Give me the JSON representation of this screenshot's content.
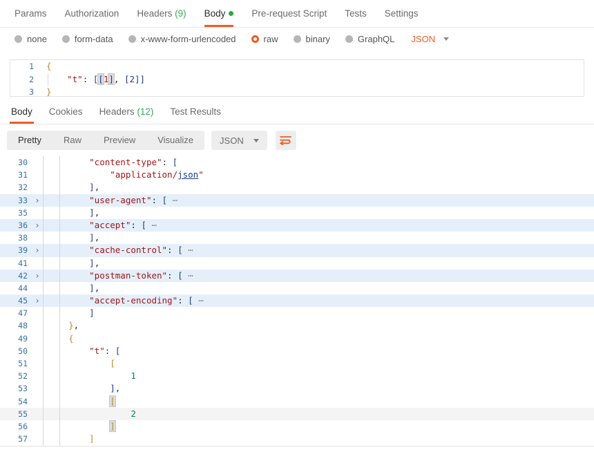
{
  "request": {
    "tabs": [
      {
        "label": "Params",
        "active": false
      },
      {
        "label": "Authorization",
        "active": false
      },
      {
        "label": "Headers",
        "count": "(9)",
        "active": false
      },
      {
        "label": "Body",
        "active": true,
        "dot": true
      },
      {
        "label": "Pre-request Script",
        "active": false
      },
      {
        "label": "Tests",
        "active": false
      },
      {
        "label": "Settings",
        "active": false
      }
    ],
    "body_modes": [
      {
        "label": "none",
        "selected": false
      },
      {
        "label": "form-data",
        "selected": false
      },
      {
        "label": "x-www-form-urlencoded",
        "selected": false
      },
      {
        "label": "raw",
        "selected": true
      },
      {
        "label": "binary",
        "selected": false
      },
      {
        "label": "GraphQL",
        "selected": false
      }
    ],
    "format": "JSON",
    "editor": {
      "lines": [
        {
          "num": "1",
          "tokens": [
            {
              "t": "{",
              "c": "t-brace"
            }
          ]
        },
        {
          "num": "2",
          "indent": true,
          "tokens": [
            {
              "t": "    ",
              "c": "t-punc"
            },
            {
              "t": "\"t\"",
              "c": "t-key"
            },
            {
              "t": ": ",
              "c": "t-punc"
            },
            {
              "t": "[",
              "c": "t-brk"
            },
            {
              "t": "[",
              "c": "t-brk bmatch"
            },
            {
              "t": "1",
              "c": "t-numr"
            },
            {
              "t": "]",
              "c": "t-brk bmatch"
            },
            {
              "t": ", ",
              "c": "t-punc"
            },
            {
              "t": "[2]",
              "c": "t-brk"
            },
            {
              "t": "]",
              "c": "t-brk"
            }
          ]
        },
        {
          "num": "3",
          "tokens": [
            {
              "t": "}",
              "c": "t-brace"
            }
          ]
        }
      ]
    }
  },
  "response": {
    "tabs": [
      {
        "label": "Body",
        "active": true
      },
      {
        "label": "Cookies",
        "active": false
      },
      {
        "label": "Headers",
        "count": "(12)",
        "active": false
      },
      {
        "label": "Test Results",
        "active": false
      }
    ],
    "view_modes": [
      {
        "label": "Pretty",
        "active": true
      },
      {
        "label": "Raw",
        "active": false
      },
      {
        "label": "Preview",
        "active": false
      },
      {
        "label": "Visualize",
        "active": false
      }
    ],
    "format": "JSON",
    "wrap_icon": "word-wrap-icon",
    "lines": [
      {
        "num": "30",
        "fold": "",
        "hl": false,
        "tokens": [
          {
            "t": "      ",
            "c": "t-punc"
          },
          {
            "t": "\"content-type\"",
            "c": "t-key"
          },
          {
            "t": ": ",
            "c": "t-punc"
          },
          {
            "t": "[",
            "c": "t-brk"
          }
        ]
      },
      {
        "num": "31",
        "fold": "",
        "hl": false,
        "tokens": [
          {
            "t": "          ",
            "c": "t-punc"
          },
          {
            "t": "\"application/",
            "c": "t-str"
          },
          {
            "t": "json",
            "c": "t-link"
          },
          {
            "t": "\"",
            "c": "t-str"
          }
        ]
      },
      {
        "num": "32",
        "fold": "",
        "hl": false,
        "tokens": [
          {
            "t": "      ",
            "c": "t-punc"
          },
          {
            "t": "]",
            "c": "t-brk"
          },
          {
            "t": ",",
            "c": "t-punc"
          }
        ]
      },
      {
        "num": "33",
        "fold": "›",
        "hl": true,
        "tokens": [
          {
            "t": "      ",
            "c": "t-punc"
          },
          {
            "t": "\"user-agent\"",
            "c": "t-key"
          },
          {
            "t": ": ",
            "c": "t-punc"
          },
          {
            "t": "[",
            "c": "t-brk"
          },
          {
            "t": " ⋯",
            "c": "t-ell"
          }
        ]
      },
      {
        "num": "35",
        "fold": "",
        "hl": false,
        "tokens": [
          {
            "t": "      ",
            "c": "t-punc"
          },
          {
            "t": "]",
            "c": "t-brk"
          },
          {
            "t": ",",
            "c": "t-punc"
          }
        ]
      },
      {
        "num": "36",
        "fold": "›",
        "hl": true,
        "tokens": [
          {
            "t": "      ",
            "c": "t-punc"
          },
          {
            "t": "\"accept\"",
            "c": "t-key"
          },
          {
            "t": ": ",
            "c": "t-punc"
          },
          {
            "t": "[",
            "c": "t-brk"
          },
          {
            "t": " ⋯",
            "c": "t-ell"
          }
        ]
      },
      {
        "num": "38",
        "fold": "",
        "hl": false,
        "tokens": [
          {
            "t": "      ",
            "c": "t-punc"
          },
          {
            "t": "]",
            "c": "t-brk"
          },
          {
            "t": ",",
            "c": "t-punc"
          }
        ]
      },
      {
        "num": "39",
        "fold": "›",
        "hl": true,
        "tokens": [
          {
            "t": "      ",
            "c": "t-punc"
          },
          {
            "t": "\"cache-control\"",
            "c": "t-key"
          },
          {
            "t": ": ",
            "c": "t-punc"
          },
          {
            "t": "[",
            "c": "t-brk"
          },
          {
            "t": " ⋯",
            "c": "t-ell"
          }
        ]
      },
      {
        "num": "41",
        "fold": "",
        "hl": false,
        "tokens": [
          {
            "t": "      ",
            "c": "t-punc"
          },
          {
            "t": "]",
            "c": "t-brk"
          },
          {
            "t": ",",
            "c": "t-punc"
          }
        ]
      },
      {
        "num": "42",
        "fold": "›",
        "hl": true,
        "tokens": [
          {
            "t": "      ",
            "c": "t-punc"
          },
          {
            "t": "\"postman-token\"",
            "c": "t-key"
          },
          {
            "t": ": ",
            "c": "t-punc"
          },
          {
            "t": "[",
            "c": "t-brk"
          },
          {
            "t": " ⋯",
            "c": "t-ell"
          }
        ]
      },
      {
        "num": "44",
        "fold": "",
        "hl": false,
        "tokens": [
          {
            "t": "      ",
            "c": "t-punc"
          },
          {
            "t": "]",
            "c": "t-brk"
          },
          {
            "t": ",",
            "c": "t-punc"
          }
        ]
      },
      {
        "num": "45",
        "fold": "›",
        "hl": true,
        "tokens": [
          {
            "t": "      ",
            "c": "t-punc"
          },
          {
            "t": "\"accept-encoding\"",
            "c": "t-key"
          },
          {
            "t": ": ",
            "c": "t-punc"
          },
          {
            "t": "[",
            "c": "t-brk"
          },
          {
            "t": " ⋯",
            "c": "t-ell"
          }
        ]
      },
      {
        "num": "47",
        "fold": "",
        "hl": false,
        "tokens": [
          {
            "t": "      ",
            "c": "t-punc"
          },
          {
            "t": "]",
            "c": "t-brk"
          }
        ]
      },
      {
        "num": "48",
        "fold": "",
        "hl": false,
        "tokens": [
          {
            "t": "  ",
            "c": "t-punc"
          },
          {
            "t": "}",
            "c": "t-brace"
          },
          {
            "t": ",",
            "c": "t-punc"
          }
        ]
      },
      {
        "num": "49",
        "fold": "",
        "hl": false,
        "tokens": [
          {
            "t": "  ",
            "c": "t-punc"
          },
          {
            "t": "{",
            "c": "t-brace"
          }
        ]
      },
      {
        "num": "50",
        "fold": "",
        "hl": false,
        "tokens": [
          {
            "t": "      ",
            "c": "t-punc"
          },
          {
            "t": "\"t\"",
            "c": "t-key"
          },
          {
            "t": ": ",
            "c": "t-punc"
          },
          {
            "t": "[",
            "c": "t-brk"
          }
        ]
      },
      {
        "num": "51",
        "fold": "",
        "hl": false,
        "tokens": [
          {
            "t": "          ",
            "c": "t-punc"
          },
          {
            "t": "[",
            "c": "t-brace"
          }
        ]
      },
      {
        "num": "52",
        "fold": "",
        "hl": false,
        "tokens": [
          {
            "t": "              ",
            "c": "t-punc"
          },
          {
            "t": "1",
            "c": "t-num"
          }
        ]
      },
      {
        "num": "53",
        "fold": "",
        "hl": false,
        "tokens": [
          {
            "t": "          ",
            "c": "t-punc"
          },
          {
            "t": "]",
            "c": "t-brk"
          },
          {
            "t": ",",
            "c": "t-punc"
          }
        ]
      },
      {
        "num": "54",
        "fold": "",
        "hl": false,
        "tokens": [
          {
            "t": "          ",
            "c": "t-punc"
          },
          {
            "t": "[",
            "c": "t-brace bmatch"
          }
        ]
      },
      {
        "num": "55",
        "fold": "",
        "cur": true,
        "tokens": [
          {
            "t": "              ",
            "c": "t-punc"
          },
          {
            "t": "2",
            "c": "t-num"
          }
        ]
      },
      {
        "num": "56",
        "fold": "",
        "hl": false,
        "tokens": [
          {
            "t": "          ",
            "c": "t-punc"
          },
          {
            "t": "]",
            "c": "t-brace bmatch"
          }
        ]
      },
      {
        "num": "57",
        "fold": "",
        "hl": false,
        "tokens": [
          {
            "t": "      ",
            "c": "t-punc"
          },
          {
            "t": "]",
            "c": "t-brace"
          }
        ]
      }
    ]
  },
  "colors": {
    "accent": "#ef5b25",
    "green": "#2aa745",
    "highlight_row": "#e4effa",
    "cursor_row": "#f4f4f4",
    "gutter_num": "#3b6ea5"
  }
}
